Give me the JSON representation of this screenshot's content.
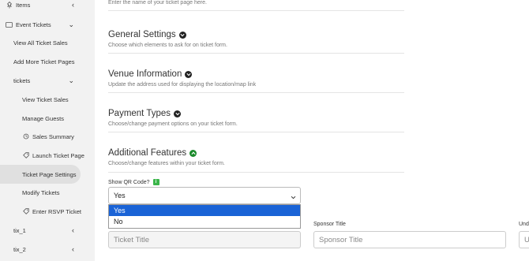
{
  "sidebar": {
    "items": [
      {
        "label": "Items",
        "icon": "pin-icon",
        "chevron": "‹"
      },
      {
        "label": "Event Tickets",
        "icon": "ticket-icon",
        "chevron": "⌄"
      },
      {
        "label": "View All Ticket Sales"
      },
      {
        "label": "Add More Ticket Pages"
      },
      {
        "label": "tickets",
        "chevron": "⌄"
      },
      {
        "label": "View Ticket Sales"
      },
      {
        "label": "Manage Guests"
      },
      {
        "label": "Sales Summary",
        "icon": "refresh-icon"
      },
      {
        "label": "Launch Ticket Page",
        "icon": "tag-icon"
      },
      {
        "label": "Ticket Page Settings"
      },
      {
        "label": "Modify Tickets"
      },
      {
        "label": "Enter RSVP Ticket",
        "icon": "tag-icon"
      },
      {
        "label": "tix_1",
        "chevron": "‹"
      },
      {
        "label": "tix_2",
        "chevron": "‹"
      }
    ]
  },
  "main": {
    "top_hint": "Enter the name of your ticket page here.",
    "sections": [
      {
        "title": "General Settings",
        "desc": "Choose which elements to ask for on ticket form."
      },
      {
        "title": "Venue Information",
        "desc": "Update the address used for displaying the location/map link"
      },
      {
        "title": "Payment Types",
        "desc": "Choose/change payment options on your ticket form."
      },
      {
        "title": "Additional Features",
        "desc": "Choose/change features within your ticket form."
      }
    ],
    "qr": {
      "label": "Show QR Code?",
      "info": "i",
      "value": "Yes",
      "options": [
        "Yes",
        "No"
      ]
    },
    "fields": {
      "ticket_title_placeholder": "Ticket Title",
      "sponsor_label": "Sponsor Title",
      "sponsor_placeholder": "Sponsor Title",
      "third_label": "Und",
      "third_placeholder": "U"
    }
  }
}
